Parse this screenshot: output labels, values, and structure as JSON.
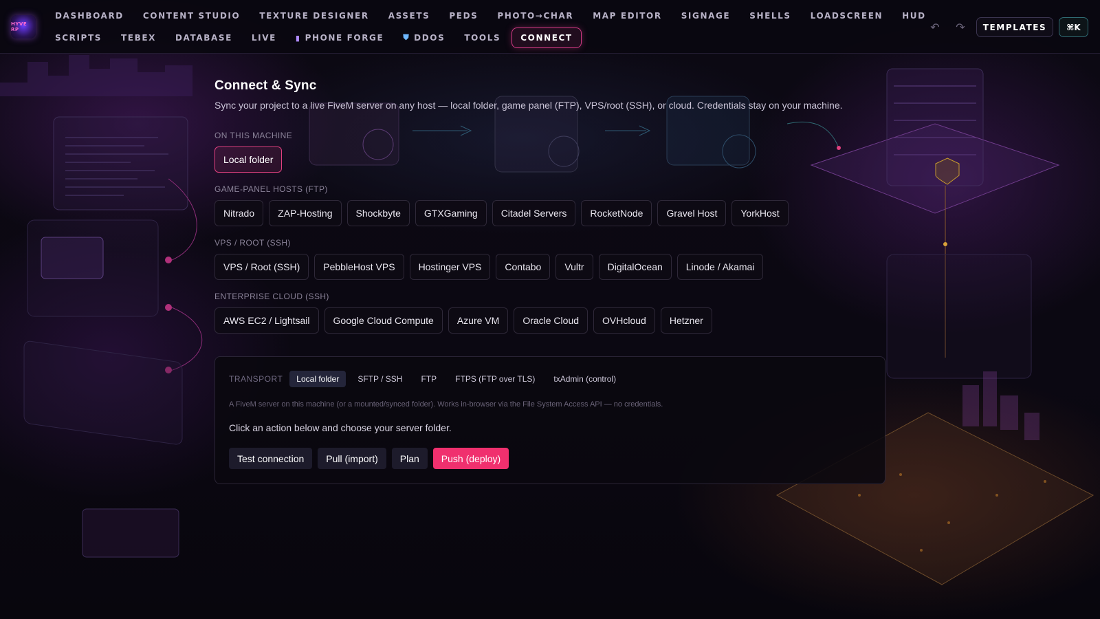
{
  "logo": {
    "text": "HYVE RP"
  },
  "nav": {
    "row1": [
      "DASHBOARD",
      "CONTENT STUDIO",
      "TEXTURE DESIGNER",
      "ASSETS",
      "PEDS",
      "PHOTO→CHAR",
      "MAP EDITOR",
      "SIGNAGE",
      "SHELLS",
      "LOADSCREEN",
      "HUD"
    ],
    "row2": [
      {
        "label": "SCRIPTS",
        "icon": null
      },
      {
        "label": "TEBEX",
        "icon": null
      },
      {
        "label": "DATABASE",
        "icon": null
      },
      {
        "label": "LIVE",
        "icon": null
      },
      {
        "label": "PHONE FORGE",
        "icon": "phone-icon"
      },
      {
        "label": "DDOS",
        "icon": "shield-icon"
      },
      {
        "label": "TOOLS",
        "icon": null
      },
      {
        "label": "CONNECT",
        "icon": null,
        "active": true
      }
    ],
    "templates_label": "TEMPLATES",
    "cmdk_label": "⌘K"
  },
  "page": {
    "title": "Connect & Sync",
    "subtitle": "Sync your project to a live FiveM server on any host — local folder, game panel (FTP), VPS/root (SSH), or cloud. Credentials stay on your machine."
  },
  "groups": [
    {
      "label": "ON THIS MACHINE",
      "hosts": [
        "Local folder"
      ],
      "selected": "Local folder"
    },
    {
      "label": "GAME-PANEL HOSTS (FTP)",
      "hosts": [
        "Nitrado",
        "ZAP-Hosting",
        "Shockbyte",
        "GTXGaming",
        "Citadel Servers",
        "RocketNode",
        "Gravel Host",
        "YorkHost"
      ]
    },
    {
      "label": "VPS / ROOT (SSH)",
      "hosts": [
        "VPS / Root (SSH)",
        "PebbleHost VPS",
        "Hostinger VPS",
        "Contabo",
        "Vultr",
        "DigitalOcean",
        "Linode / Akamai"
      ]
    },
    {
      "label": "ENTERPRISE CLOUD (SSH)",
      "hosts": [
        "AWS EC2 / Lightsail",
        "Google Cloud Compute",
        "Azure VM",
        "Oracle Cloud",
        "OVHcloud",
        "Hetzner"
      ]
    }
  ],
  "transport": {
    "label": "TRANSPORT",
    "tabs": [
      "Local folder",
      "SFTP / SSH",
      "FTP",
      "FTPS (FTP over TLS)",
      "txAdmin (control)"
    ],
    "active": "Local folder",
    "note": "A FiveM server on this machine (or a mounted/synced folder). Works in-browser via the File System Access API — no credentials.",
    "instruction": "Click an action below and choose your server folder.",
    "actions": {
      "test": "Test connection",
      "pull": "Pull (import)",
      "plan": "Plan",
      "push": "Push (deploy)"
    }
  },
  "colors": {
    "accent": "#f0306e",
    "active_nav_border": "#d43a86",
    "background": "#0a0710"
  }
}
